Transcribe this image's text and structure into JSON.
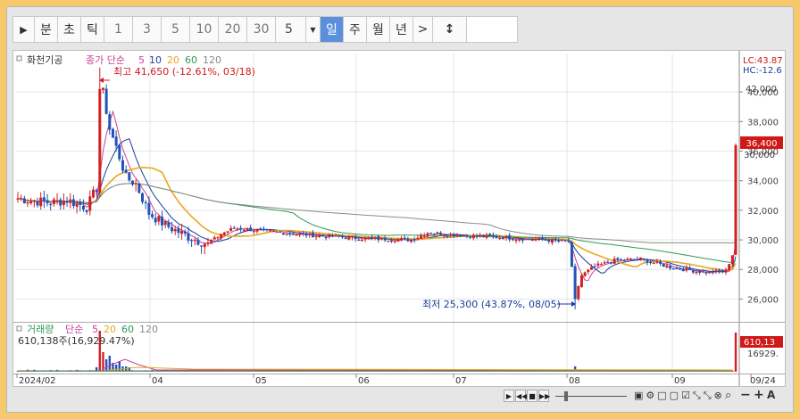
{
  "toolbar": {
    "play_icon": "play-icon",
    "buttons": [
      "분",
      "초",
      "틱"
    ],
    "intervals": [
      "1",
      "3",
      "5",
      "10",
      "20",
      "30"
    ],
    "select_value": "5",
    "period_buttons": [
      "일",
      "주",
      "월",
      "년"
    ],
    "active_period": "일",
    "more_label": ">",
    "updown_icon": "up-down-arrow-icon"
  },
  "price_panel": {
    "stock_name": "화천기공",
    "indicator_label": "종가 단순",
    "ma_periods": [
      "5",
      "10",
      "20",
      "60",
      "120"
    ],
    "ma_colors": [
      "#c8429a",
      "#1a3e9a",
      "#e8a81e",
      "#2e9a56",
      "#8a8a8a"
    ],
    "high_label": "최고 41,650 (-12.61%, 03/18)",
    "low_label": "최저 25,300 (43.87%, 08/05)",
    "lc_label": "LC:43.87",
    "hc_label": "HC:-12.6",
    "current_price_label": "36,400",
    "y_ticks": [
      "40,000",
      "38,000",
      "36,000",
      "34,000",
      "32,000",
      "30,000",
      "28,000",
      "26,000"
    ],
    "y_tick_values": [
      40000,
      38000,
      36000,
      34000,
      32000,
      30000,
      28000,
      26000
    ],
    "y_partial_top": "42,000",
    "y_partial_current": "30,000"
  },
  "volume_panel": {
    "title": "거래량",
    "indicator_label": "단순",
    "ma_periods": [
      "5",
      "20",
      "60",
      "120"
    ],
    "ma_colors": [
      "#c8429a",
      "#e8a81e",
      "#2e9a56",
      "#8a8a8a"
    ],
    "value_label": "610,138주(16,929.47%)",
    "tag_value": "610,13",
    "tag_pct": "16929."
  },
  "x_axis": {
    "labels": [
      "2024/02",
      "04",
      "05",
      "06",
      "07",
      "08",
      "09",
      "09/24"
    ]
  },
  "controls": {
    "icons": [
      "play-icon",
      "rewind-icon",
      "stop-icon",
      "forward-icon"
    ]
  },
  "chart_data": {
    "type": "candlestick",
    "ylim": [
      24700,
      42600
    ],
    "series": [
      {
        "name": "종가",
        "x": [
          "02",
          "03/18",
          "04",
          "05",
          "06",
          "07",
          "08/05",
          "08",
          "09",
          "09/24"
        ],
        "values": [
          32800,
          41650,
          31000,
          30600,
          30300,
          30000,
          25300,
          28600,
          28200,
          36400
        ]
      }
    ],
    "annotations": [
      {
        "text": "최고 41,650 (-12.61%, 03/18)",
        "x": "03/18",
        "y": 41650
      },
      {
        "text": "최저 25,300 (43.87%, 08/05)",
        "x": "08/05",
        "y": 25300
      }
    ],
    "volume": {
      "title": "거래량",
      "last": 610138,
      "last_change_pct": 16929.47
    }
  }
}
